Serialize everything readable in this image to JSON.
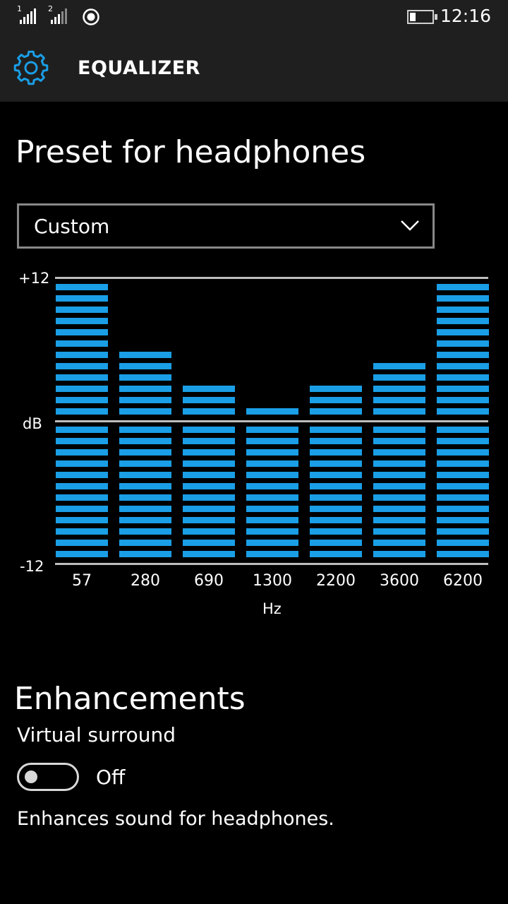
{
  "status_bar": {
    "sim1_label": "1",
    "sim2_label": "2",
    "time": "12:16",
    "battery_level": 0.25
  },
  "header": {
    "title": "EQUALIZER",
    "icon": "gear-icon"
  },
  "preset": {
    "title": "Preset for headphones",
    "selected": "Custom",
    "icon": "chevron-down-icon"
  },
  "equalizer": {
    "top_label": "+12",
    "mid_label": "dB",
    "bottom_label": "-12",
    "x_unit": "Hz",
    "bar_color": "#1a9ee6",
    "segments_per_half": 12,
    "bands": [
      {
        "freq": "57",
        "level": 12
      },
      {
        "freq": "280",
        "level": 6
      },
      {
        "freq": "690",
        "level": 3
      },
      {
        "freq": "1300",
        "level": 1
      },
      {
        "freq": "2200",
        "level": 3
      },
      {
        "freq": "3600",
        "level": 5
      },
      {
        "freq": "6200",
        "level": 12
      }
    ]
  },
  "enhancements": {
    "title": "Enhancements",
    "virtual_surround_label": "Virtual surround",
    "toggle_state": "Off",
    "description": "Enhances sound for headphones."
  }
}
